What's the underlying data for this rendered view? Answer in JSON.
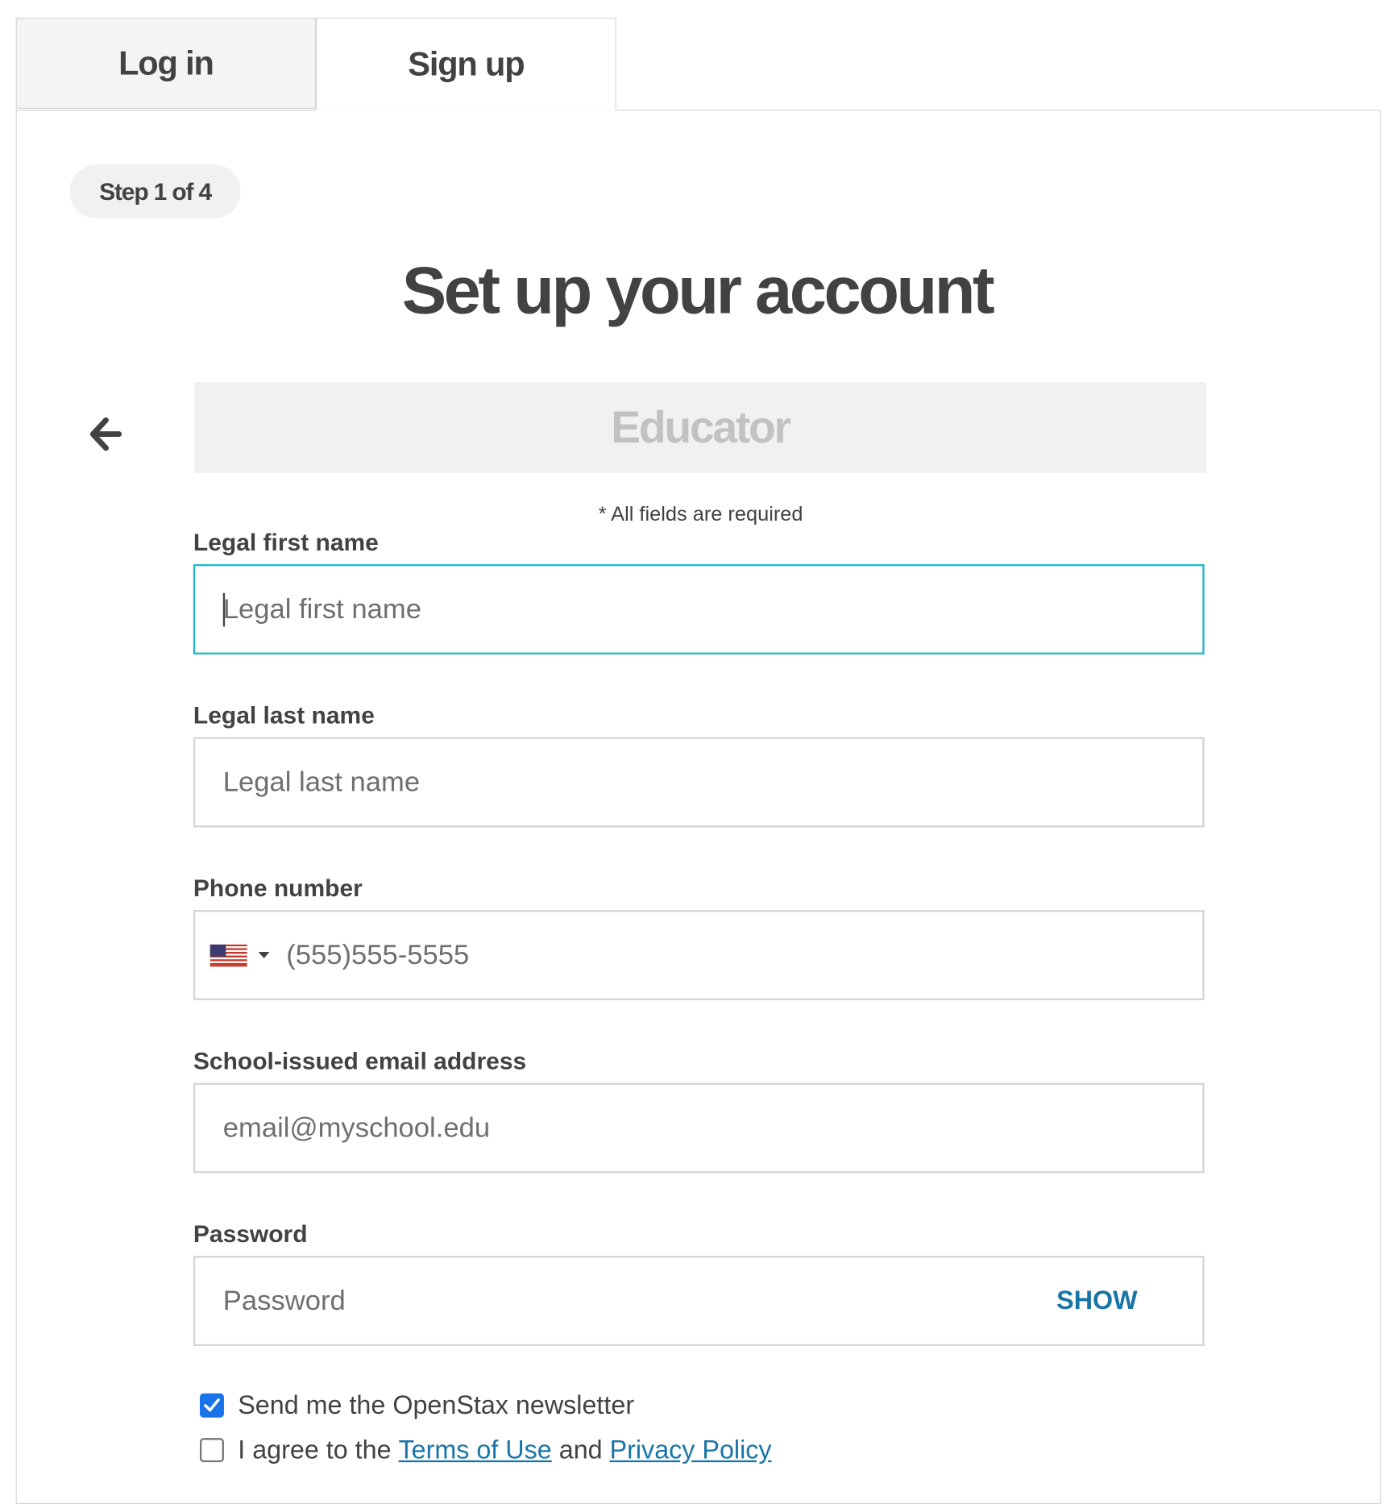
{
  "tabs": [
    {
      "label": "Log in",
      "active": false
    },
    {
      "label": "Sign up",
      "active": true
    }
  ],
  "step_label": "Step 1 of 4",
  "title": "Set up your account",
  "role": "Educator",
  "required_note": "* All fields are required",
  "fields": {
    "first_name": {
      "label": "Legal first name",
      "placeholder": "Legal first name",
      "value": ""
    },
    "last_name": {
      "label": "Legal last name",
      "placeholder": "Legal last name",
      "value": ""
    },
    "phone": {
      "label": "Phone number",
      "placeholder": "(555)555-5555",
      "value": "",
      "country_icon": "us-flag-icon"
    },
    "email": {
      "label": "School-issued email address",
      "placeholder": "email@myschool.edu",
      "value": ""
    },
    "password": {
      "label": "Password",
      "placeholder": "Password",
      "value": "",
      "toggle_label": "SHOW"
    }
  },
  "newsletter": {
    "label": "Send me the OpenStax newsletter",
    "checked": true
  },
  "agreement": {
    "prefix": "I agree to the",
    "terms_link": "Terms of Use",
    "conjunction": "and",
    "privacy_link": "Privacy Policy",
    "checked": false
  },
  "colors": {
    "focus_border": "#1eb6cd",
    "link": "#1a75a7",
    "checkbox_checked": "#1a73e8",
    "text": "#424242"
  }
}
